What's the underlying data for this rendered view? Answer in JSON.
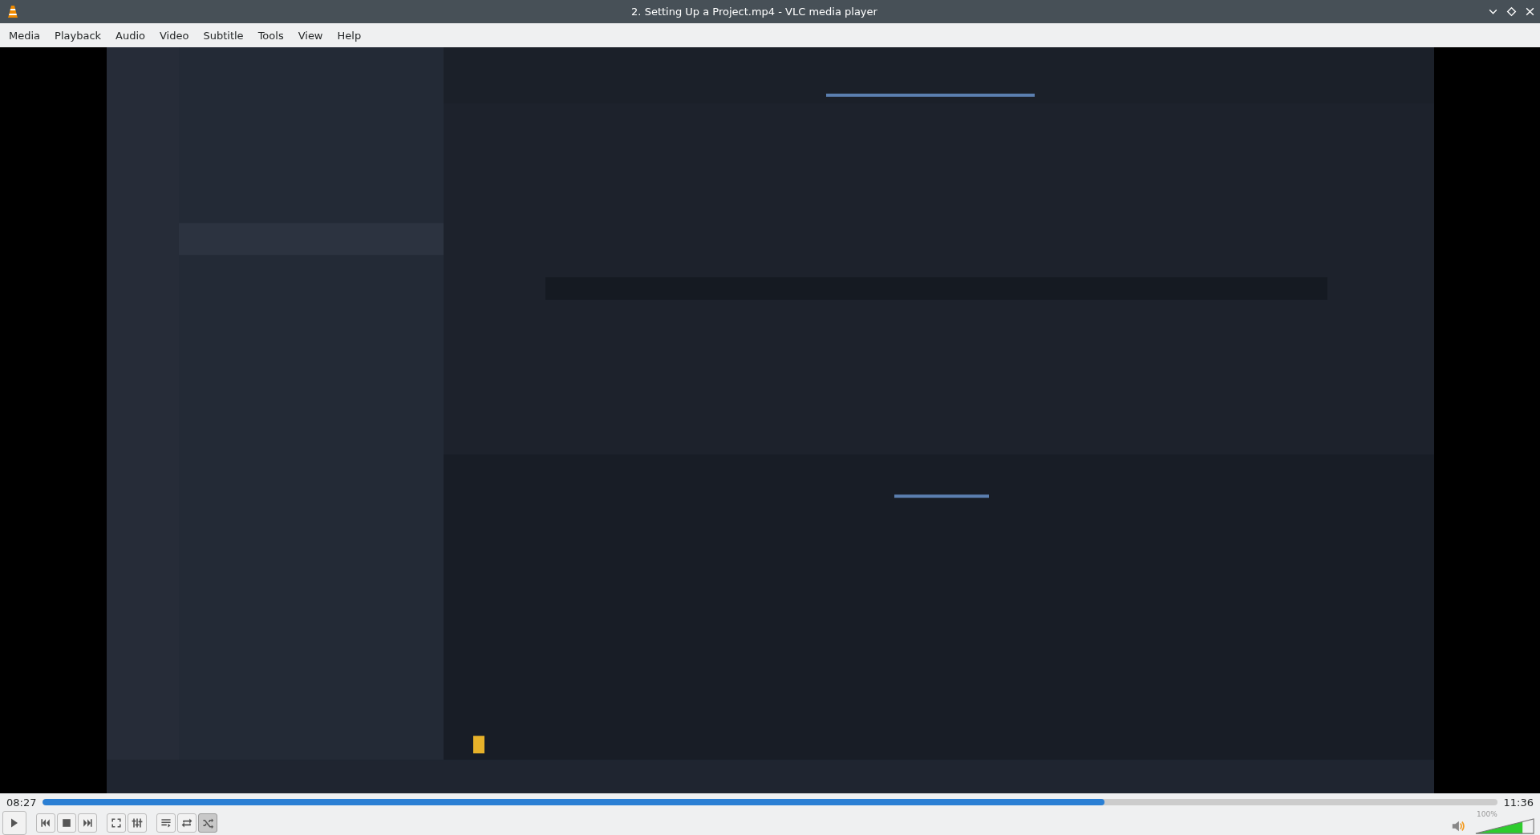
{
  "window": {
    "title": "2. Setting Up a Project.mp4 - VLC media player"
  },
  "menu": [
    "Media",
    "Playback",
    "Audio",
    "Video",
    "Subtitle",
    "Tools",
    "View",
    "Help"
  ],
  "video": {
    "kind": "picture"
  },
  "seek": {
    "elapsed": "08:27",
    "total": "11:36",
    "level": 0.73
  },
  "controls": [
    {
      "kind": "play"
    },
    {
      "kind": "previous"
    },
    {
      "kind": "stop"
    },
    {
      "kind": "next"
    },
    {
      "kind": "fullscreen"
    },
    {
      "kind": "extended"
    },
    {
      "kind": "playlist"
    },
    {
      "kind": "loop",
      "on": false
    },
    {
      "kind": "shuffle",
      "on": true
    }
  ],
  "volume": {
    "reading": "100%",
    "level": 0.8,
    "muted": false
  }
}
